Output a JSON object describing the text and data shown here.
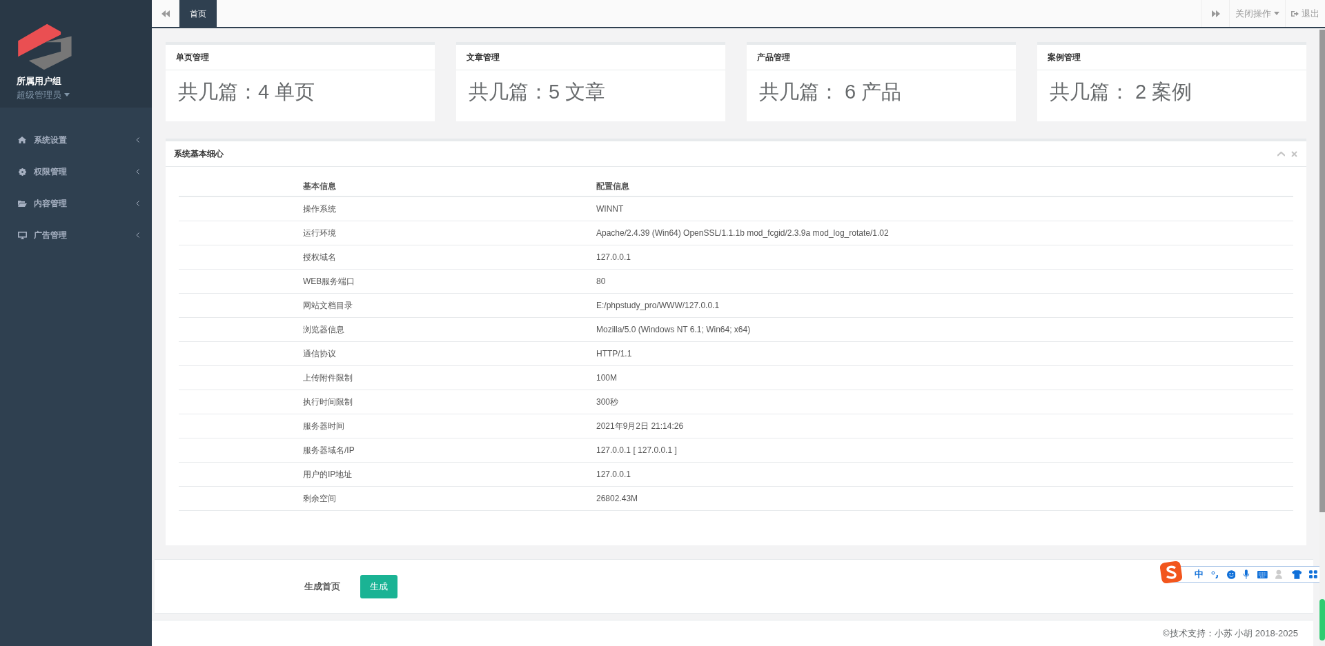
{
  "sidebar": {
    "group_label": "所属用户组",
    "role": "超级管理员",
    "items": [
      {
        "label": "系统设置",
        "kind": "home"
      },
      {
        "label": "权限管理",
        "kind": "gear"
      },
      {
        "label": "内容管理",
        "kind": "folder"
      },
      {
        "label": "广告管理",
        "kind": "monitor"
      }
    ]
  },
  "topbar": {
    "tabs": [
      {
        "label": "首页",
        "selected": true
      }
    ],
    "close_menu": "关闭操作",
    "logout": "退出"
  },
  "stat_cards": [
    {
      "title": "单页管理",
      "value": "共几篇：4 单页"
    },
    {
      "title": "文章管理",
      "value": "共几篇：5 文章"
    },
    {
      "title": "产品管理",
      "value": "共几篇： 6 产品"
    },
    {
      "title": "案例管理",
      "value": "共几篇： 2 案例"
    }
  ],
  "info_panel": {
    "title": "系统基本细心",
    "columns": [
      "基本信息",
      "配置信息"
    ],
    "rows": [
      [
        "操作系统",
        "WINNT"
      ],
      [
        "运行环境",
        "Apache/2.4.39 (Win64) OpenSSL/1.1.1b mod_fcgid/2.3.9a mod_log_rotate/1.02"
      ],
      [
        "授权域名",
        "127.0.0.1"
      ],
      [
        "WEB服务端口",
        "80"
      ],
      [
        "网站文档目录",
        "E:/phpstudy_pro/WWW/127.0.0.1"
      ],
      [
        "浏览器信息",
        "Mozilla/5.0 (Windows NT 6.1; Win64; x64)"
      ],
      [
        "通信协议",
        "HTTP/1.1"
      ],
      [
        "上传附件限制",
        "100M"
      ],
      [
        "执行时间限制",
        "300秒"
      ],
      [
        "服务器时间",
        "2021年9月2日 21:14:26"
      ],
      [
        "服务器域名/IP",
        "127.0.0.1 [ 127.0.0.1 ]"
      ],
      [
        "用户的IP地址",
        "127.0.0.1"
      ],
      [
        "剩余空间",
        "26802.43M"
      ]
    ]
  },
  "generate": {
    "label": "生成首页",
    "button": "生成"
  },
  "ime_toolbar": {
    "mode": "中"
  },
  "footer": "©技术支持：小苏 小胡 2018-2025"
}
